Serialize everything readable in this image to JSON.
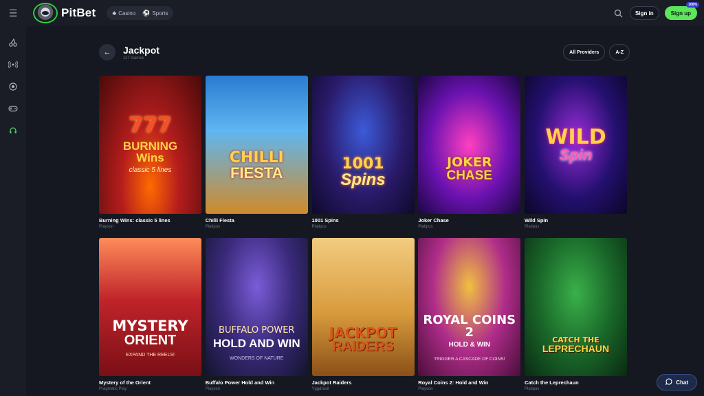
{
  "brand": {
    "name": "PitBet"
  },
  "nav": {
    "switch": [
      {
        "label": "Casino",
        "icon": "cherry-icon"
      },
      {
        "label": "Sports",
        "icon": "ball-icon"
      }
    ]
  },
  "header": {
    "signin_label": "Sign in",
    "signup_label": "Sign up",
    "signup_badge": "100%"
  },
  "sidebar": {
    "items": [
      {
        "icon": "cherries-icon"
      },
      {
        "icon": "live-icon"
      },
      {
        "icon": "soccer-ball-icon"
      },
      {
        "icon": "gamepad-icon"
      },
      {
        "icon": "support-icon",
        "active": true
      }
    ]
  },
  "page": {
    "title": "Jackpot",
    "subtitle": "117 Games",
    "filters": {
      "providers_label": "All Providers",
      "sort_label": "A-Z"
    }
  },
  "games": [
    {
      "name": "Burning Wins: classic 5 lines",
      "provider": "Playson",
      "art": {
        "line1": "777",
        "line2": "BURNING Wins",
        "line3": "classic 5 lines"
      }
    },
    {
      "name": "Chilli Fiesta",
      "provider": "Platipus",
      "art": {
        "line1": "CHILLI",
        "line2": "FIESTA",
        "line3": ""
      }
    },
    {
      "name": "1001 Spins",
      "provider": "Platipus",
      "art": {
        "line1": "1001",
        "line2": "Spins",
        "line3": ""
      }
    },
    {
      "name": "Joker Chase",
      "provider": "Platipus",
      "art": {
        "line1": "JOKER",
        "line2": "CHASE",
        "line3": ""
      }
    },
    {
      "name": "Wild Spin",
      "provider": "Platipus",
      "art": {
        "line1": "WILD",
        "line2": "Spin",
        "line3": ""
      }
    },
    {
      "name": "Mystery of the Orient",
      "provider": "Pragmatic Play",
      "art": {
        "line1": "MYSTERY",
        "line2": "ORIENT",
        "line3": "EXPAND THE REELS!"
      }
    },
    {
      "name": "Buffalo Power Hold and Win",
      "provider": "Playson",
      "art": {
        "line1": "BUFFALO POWER",
        "line2": "HOLD AND WIN",
        "line3": "WONDERS OF NATURE"
      }
    },
    {
      "name": "Jackpot Raiders",
      "provider": "Yggdrasil",
      "art": {
        "line1": "JACKPOT",
        "line2": "RAIDERS",
        "line3": ""
      }
    },
    {
      "name": "Royal Coins 2: Hold and Win",
      "provider": "Playson",
      "art": {
        "line1": "ROYAL COINS 2",
        "line2": "HOLD & WIN",
        "line3": "TRIGGER A CASCADE OF COINS!"
      }
    },
    {
      "name": "Catch the Leprechaun",
      "provider": "Platipus",
      "art": {
        "line1": "CATCH THE",
        "line2": "LEPRECHAUN",
        "line3": ""
      }
    }
  ],
  "chat": {
    "label": "Chat"
  }
}
